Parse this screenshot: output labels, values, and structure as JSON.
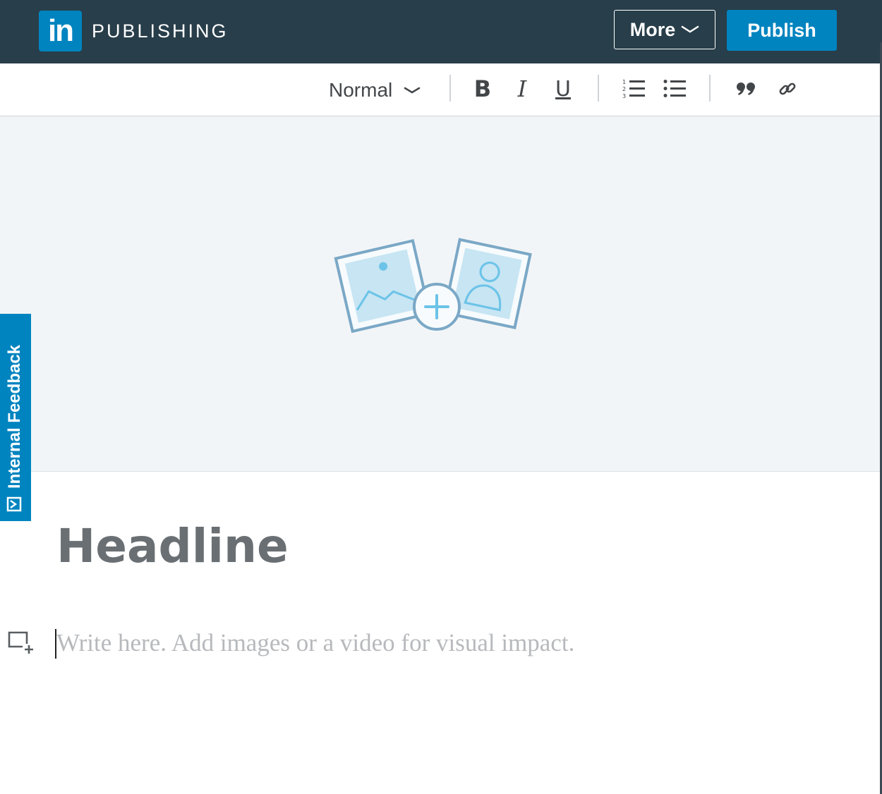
{
  "header": {
    "logo_text": "in",
    "brand": "PUBLISHING",
    "more_label": "More",
    "publish_label": "Publish"
  },
  "toolbar": {
    "format_value": "Normal",
    "bold_label": "B",
    "italic_label": "I",
    "underline_label": "U"
  },
  "feedback": {
    "label": "Internal Feedback"
  },
  "editor": {
    "headline_placeholder": "Headline",
    "body_placeholder": "Write here. Add images or a video for visual impact."
  },
  "colors": {
    "topbar": "#283e4a",
    "accent": "#0084bf",
    "cover_bg": "#f2f5f8"
  },
  "icons": [
    "chevron-down-icon",
    "numbered-list-icon",
    "bulleted-list-icon",
    "quote-icon",
    "link-icon",
    "add-image-icon",
    "feedback-icon",
    "add-media-icon"
  ]
}
